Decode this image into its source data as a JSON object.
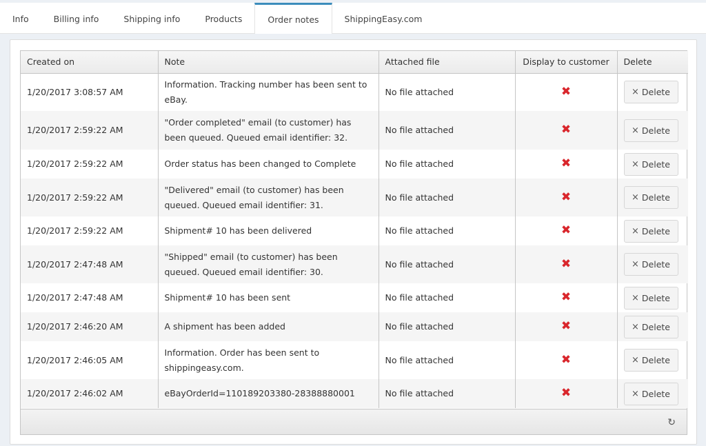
{
  "tabs": [
    {
      "label": "Info"
    },
    {
      "label": "Billing info"
    },
    {
      "label": "Shipping info"
    },
    {
      "label": "Products"
    },
    {
      "label": "Order notes",
      "active": true
    },
    {
      "label": "ShippingEasy.com"
    }
  ],
  "grid": {
    "headers": {
      "created_on": "Created on",
      "note": "Note",
      "attached_file": "Attached file",
      "display_to_customer": "Display to customer",
      "delete": "Delete"
    },
    "rows": [
      {
        "created": "1/20/2017 3:08:57 AM",
        "note": "Information. Tracking number has been sent to eBay.",
        "file": "No file attached",
        "display": "✖",
        "delete": "Delete"
      },
      {
        "created": "1/20/2017 2:59:22 AM",
        "note": "\"Order completed\" email (to customer) has been queued. Queued email identifier: 32.",
        "file": "No file attached",
        "display": "✖",
        "delete": "Delete"
      },
      {
        "created": "1/20/2017 2:59:22 AM",
        "note": "Order status has been changed to Complete",
        "file": "No file attached",
        "display": "✖",
        "delete": "Delete"
      },
      {
        "created": "1/20/2017 2:59:22 AM",
        "note": "\"Delivered\" email (to customer) has been queued. Queued email identifier: 31.",
        "file": "No file attached",
        "display": "✖",
        "delete": "Delete"
      },
      {
        "created": "1/20/2017 2:59:22 AM",
        "note": "Shipment# 10 has been delivered",
        "file": "No file attached",
        "display": "✖",
        "delete": "Delete"
      },
      {
        "created": "1/20/2017 2:47:48 AM",
        "note": "\"Shipped\" email (to customer) has been queued. Queued email identifier: 30.",
        "file": "No file attached",
        "display": "✖",
        "delete": "Delete"
      },
      {
        "created": "1/20/2017 2:47:48 AM",
        "note": "Shipment# 10 has been sent",
        "file": "No file attached",
        "display": "✖",
        "delete": "Delete"
      },
      {
        "created": "1/20/2017 2:46:20 AM",
        "note": "A shipment has been added",
        "file": "No file attached",
        "display": "✖",
        "delete": "Delete"
      },
      {
        "created": "1/20/2017 2:46:05 AM",
        "note": "Information. Order has been sent to shippingeasy.com.",
        "file": "No file attached",
        "display": "✖",
        "delete": "Delete"
      },
      {
        "created": "1/20/2017 2:46:02 AM",
        "note": "eBayOrderId=110189203380-28388880001",
        "file": "No file attached",
        "display": "✖",
        "delete": "Delete"
      }
    ]
  },
  "icons": {
    "delete": "×",
    "refresh": "↻"
  },
  "colors": {
    "accent": "#3c8dbc",
    "xmark": "#d9262c"
  }
}
